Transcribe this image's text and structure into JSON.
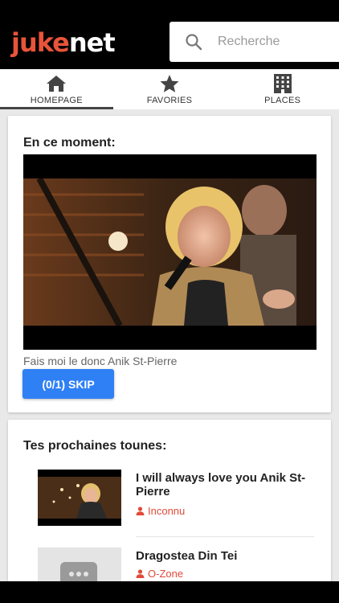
{
  "app": {
    "logo_part1": "juke",
    "logo_part2": "net",
    "accent_color": "#e8543a",
    "button_color": "#2f80f5"
  },
  "search": {
    "placeholder": "Recherche",
    "icon": "search-icon"
  },
  "tabs": [
    {
      "label": "HOMEPAGE",
      "icon": "home-icon",
      "active": true
    },
    {
      "label": "FAVORIES",
      "icon": "star-icon",
      "active": false
    },
    {
      "label": "PLACES",
      "icon": "building-icon",
      "active": false
    }
  ],
  "now_playing": {
    "heading": "En ce moment:",
    "title": "Fais moi le donc Anik St-Pierre",
    "skip_label": "(0/1) SKIP"
  },
  "queue": {
    "heading": "Tes prochaines tounes:",
    "items": [
      {
        "title": "I will always love you Anik St-Pierre",
        "artist": "Inconnu"
      },
      {
        "title": "Dragostea Din Tei",
        "artist": "O-Zone"
      }
    ]
  }
}
